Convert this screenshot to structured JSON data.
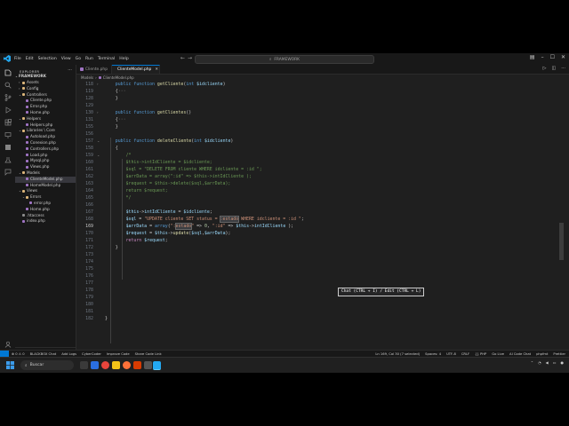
{
  "titlebar": {
    "menu": [
      "File",
      "Edit",
      "Selection",
      "View",
      "Go",
      "Run",
      "Terminal",
      "Help"
    ],
    "search_text": "FRAMEWORK"
  },
  "sidebar": {
    "header": "EXPLORER",
    "root": "FRAMEWORK",
    "items": [
      {
        "label": "Assets",
        "depth": 1,
        "type": "folder",
        "open": false
      },
      {
        "label": "Config",
        "depth": 1,
        "type": "folder",
        "open": false
      },
      {
        "label": "Controllers",
        "depth": 1,
        "type": "folder",
        "open": true
      },
      {
        "label": "Cliente.php",
        "depth": 2,
        "type": "php"
      },
      {
        "label": "Error.php",
        "depth": 2,
        "type": "php"
      },
      {
        "label": "Home.php",
        "depth": 2,
        "type": "php"
      },
      {
        "label": "Helpers",
        "depth": 1,
        "type": "folder",
        "open": true
      },
      {
        "label": "Helpers.php",
        "depth": 2,
        "type": "php"
      },
      {
        "label": "Libraries \\ Core",
        "depth": 1,
        "type": "folder",
        "open": true
      },
      {
        "label": "Autoload.php",
        "depth": 2,
        "type": "php"
      },
      {
        "label": "Conexion.php",
        "depth": 2,
        "type": "php"
      },
      {
        "label": "Controllers.php",
        "depth": 2,
        "type": "php"
      },
      {
        "label": "Load.php",
        "depth": 2,
        "type": "php"
      },
      {
        "label": "Mysql.php",
        "depth": 2,
        "type": "php"
      },
      {
        "label": "Views.php",
        "depth": 2,
        "type": "php"
      },
      {
        "label": "Models",
        "depth": 1,
        "type": "folder",
        "open": true
      },
      {
        "label": "ClienteModel.php",
        "depth": 2,
        "type": "php",
        "selected": true
      },
      {
        "label": "HomeModel.php",
        "depth": 2,
        "type": "php"
      },
      {
        "label": "Views",
        "depth": 1,
        "type": "folder",
        "open": true
      },
      {
        "label": "Errors",
        "depth": 2,
        "type": "folder",
        "open": true
      },
      {
        "label": "error.php",
        "depth": 3,
        "type": "php"
      },
      {
        "label": "Home.php",
        "depth": 2,
        "type": "php"
      },
      {
        "label": ".htaccess",
        "depth": 1,
        "type": "cfg"
      },
      {
        "label": "index.php",
        "depth": 1,
        "type": "php"
      }
    ],
    "outline": "OUTLINE",
    "timeline": "TIMELINE"
  },
  "tabs": [
    {
      "label": "Cliente.php",
      "active": false
    },
    {
      "label": "ClienteModel.php",
      "active": true
    }
  ],
  "breadcrumb": [
    "Models",
    "ClienteModel.php"
  ],
  "editor": {
    "current_line": "169",
    "lines": [
      {
        "n": "118",
        "html": "    <span class='kw'>public</span> <span class='kw'>function</span> <span class='fn'>getCliente</span>(<span class='kw'>int</span> <span class='v'>$idcliente</span>)",
        "fold": "›"
      },
      {
        "n": "119",
        "html": "    {<span class='g'>···</span>"
      },
      {
        "n": "128",
        "html": "    }"
      },
      {
        "n": "129",
        "html": ""
      },
      {
        "n": "130",
        "html": "    <span class='kw'>public</span> <span class='kw'>function</span> <span class='fn'>getClientes</span>()",
        "fold": "›"
      },
      {
        "n": "131",
        "html": "    {<span class='g'>···</span>"
      },
      {
        "n": "155",
        "html": "    }"
      },
      {
        "n": "156",
        "html": ""
      },
      {
        "n": "157",
        "html": "    <span class='kw'>public</span> <span class='kw'>function</span> <span class='fn'>deleteCliente</span>(<span class='kw'>int</span> <span class='v'>$idcliente</span>)",
        "fold": "⌄"
      },
      {
        "n": "158",
        "html": "    {"
      },
      {
        "n": "159",
        "html": "        <span class='cm'>/*</span>",
        "fold": "⌄"
      },
      {
        "n": "160",
        "html": "<span class='cm'>        $this->intIdCliente = $idcliente;</span>"
      },
      {
        "n": "161",
        "html": "<span class='cm'>        $sql = \"DELETE FROM cliente WHERE idcliente = :id \";</span>"
      },
      {
        "n": "162",
        "html": "<span class='cm'>        $arrData = array(\":id\" => $this->intIdCliente );</span>"
      },
      {
        "n": "163",
        "html": "<span class='cm'>        $request = $this->delete($sql,$arrData);</span>"
      },
      {
        "n": "164",
        "html": "<span class='cm'>        return $request;</span>"
      },
      {
        "n": "165",
        "html": "<span class='cm'>        */</span>"
      },
      {
        "n": "166",
        "html": ""
      },
      {
        "n": "167",
        "html": "        <span class='v'>$this</span>-><span class='v'>intIdCliente</span> = <span class='v'>$idcliente</span>;"
      },
      {
        "n": "168",
        "html": "        <span class='v'>$sql</span> = <span class='s'>\"UPDATE cliente SET status = </span><span class='s hl'>:estado</span><span class='s'> WHERE idcliente = :id \"</span>;"
      },
      {
        "n": "169",
        "html": "        <span class='v'>$arrData</span> = <span class='kw'>array</span>(<span class='s'>\":</span><span class='s hl'>estado</span><span class='s'>\"</span> => <span class='n'>0</span>, <span class='s'>\":id\"</span> => <span class='v'>$this</span>-><span class='v'>intIdCliente</span> );"
      },
      {
        "n": "170",
        "html": "        <span class='v'>$request</span> = <span class='v'>$this</span>-><span class='fn'>update</span>(<span class='v'>$sql</span>,<span class='v'>$arrData</span>);"
      },
      {
        "n": "171",
        "html": "        <span class='k'>return</span> <span class='v'>$request</span>;"
      },
      {
        "n": "172",
        "html": "    }"
      },
      {
        "n": "173",
        "html": ""
      },
      {
        "n": "174",
        "html": ""
      },
      {
        "n": "175",
        "html": ""
      },
      {
        "n": "176",
        "html": ""
      },
      {
        "n": "177",
        "html": ""
      },
      {
        "n": "178",
        "html": ""
      },
      {
        "n": "179",
        "html": ""
      },
      {
        "n": "180",
        "html": ""
      },
      {
        "n": "181",
        "html": ""
      },
      {
        "n": "182",
        "html": "}"
      }
    ],
    "tooltip": "Chat (CTRL + I) / Edit (CTRL + L)"
  },
  "statusbar": {
    "left": [
      "⊗ 0 ⚠ 0",
      "BLACKBOX Chat",
      "Add Logs",
      "CyberCoder",
      "Improve Code",
      "Share Code Link"
    ],
    "right": [
      "Ln 169, Col 30 (7 selected)",
      "Spaces: 4",
      "UTF-8",
      "CRLF",
      "{} PHP",
      "Go Live",
      "AI Code Chat",
      "phpfmt",
      "Prettier"
    ]
  },
  "taskbar": {
    "search_placeholder": "Buscar"
  },
  "colors": {
    "accent": "#0078d4",
    "editor_bg": "#1f1f1f",
    "sidebar_bg": "#181818"
  }
}
